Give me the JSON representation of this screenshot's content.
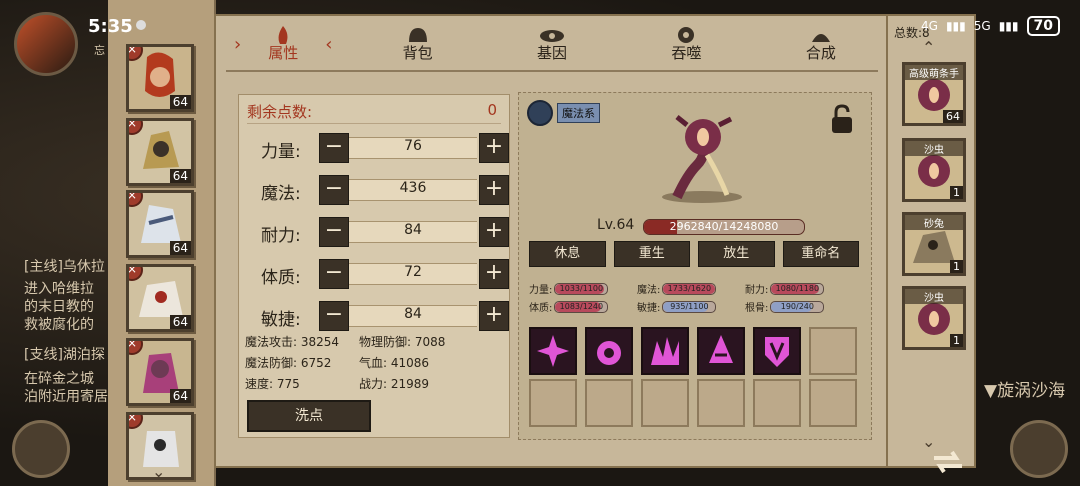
{
  "status_bar": {
    "time": "5:35",
    "network_1": "4G",
    "network_2": "5G",
    "battery": "70"
  },
  "background": {
    "quest_main": "[主线]乌休拉",
    "quest_main_desc_1": "进入哈维拉",
    "quest_main_desc_2": "的末日教的",
    "quest_main_desc_3": "救被腐化的",
    "quest_side": "[支线]湖泊探",
    "quest_side_desc_1": "在碎金之城",
    "quest_side_desc_2": "泊附近用寄居",
    "location": "▼旋涡沙海",
    "player_label": "忘"
  },
  "tabs": [
    {
      "label": "属性",
      "icon": "flame-icon",
      "active": true
    },
    {
      "label": "背包",
      "icon": "backpack-icon",
      "active": false
    },
    {
      "label": "基因",
      "icon": "eye-icon",
      "active": false
    },
    {
      "label": "吞噬",
      "icon": "devour-icon",
      "active": false
    },
    {
      "label": "合成",
      "icon": "craft-icon",
      "active": false
    }
  ],
  "characters": [
    {
      "level": "64"
    },
    {
      "level": "64"
    },
    {
      "level": "64"
    },
    {
      "level": "64"
    },
    {
      "level": "64"
    },
    {
      "level": ""
    }
  ],
  "attributes": {
    "remaining_label": "剩余点数:",
    "remaining_value": "0",
    "rows": [
      {
        "name": "力量:",
        "value": "76"
      },
      {
        "name": "魔法:",
        "value": "436"
      },
      {
        "name": "耐力:",
        "value": "84"
      },
      {
        "name": "体质:",
        "value": "72"
      },
      {
        "name": "敏捷:",
        "value": "84"
      }
    ],
    "derived": {
      "magic_attack": "魔法攻击: 38254",
      "phys_defense": "物理防御: 7088",
      "magic_defense": "魔法防御: 6752",
      "hp": "气血: 41086",
      "speed": "速度: 775",
      "power": "战力: 21989"
    },
    "reset_label": "洗点"
  },
  "pet": {
    "type_tag": "魔法系",
    "level": "Lv.64",
    "exp_text": "2962840/14248080",
    "exp_ratio": 0.208,
    "actions": [
      "休息",
      "重生",
      "放生",
      "重命名"
    ],
    "growth": [
      {
        "label": "力量:",
        "text": "1033/1100",
        "ratio": 0.94,
        "color": "#b84a5c"
      },
      {
        "label": "魔法:",
        "text": "1733/1620",
        "ratio": 1.0,
        "color": "#b84a5c"
      },
      {
        "label": "耐力:",
        "text": "1080/1180",
        "ratio": 0.92,
        "color": "#b84a5c"
      },
      {
        "label": "体质:",
        "text": "1083/1240",
        "ratio": 0.87,
        "color": "#b84a5c"
      },
      {
        "label": "敏捷:",
        "text": "935/1100",
        "ratio": 0.85,
        "color": "#8f9fc5"
      },
      {
        "label": "根骨:",
        "text": "190/240",
        "ratio": 0.79,
        "color": "#8f9fc5"
      }
    ],
    "skills_filled": 5,
    "skill_slots": 12,
    "skill_color": "#e055d6"
  },
  "pet_list": {
    "title": "总数:8",
    "pets": [
      {
        "name": "高级萌条手",
        "level": "64"
      },
      {
        "name": "沙虫",
        "level": "1"
      },
      {
        "name": "砂兔",
        "level": "1"
      },
      {
        "name": "沙虫",
        "level": "1"
      }
    ]
  }
}
